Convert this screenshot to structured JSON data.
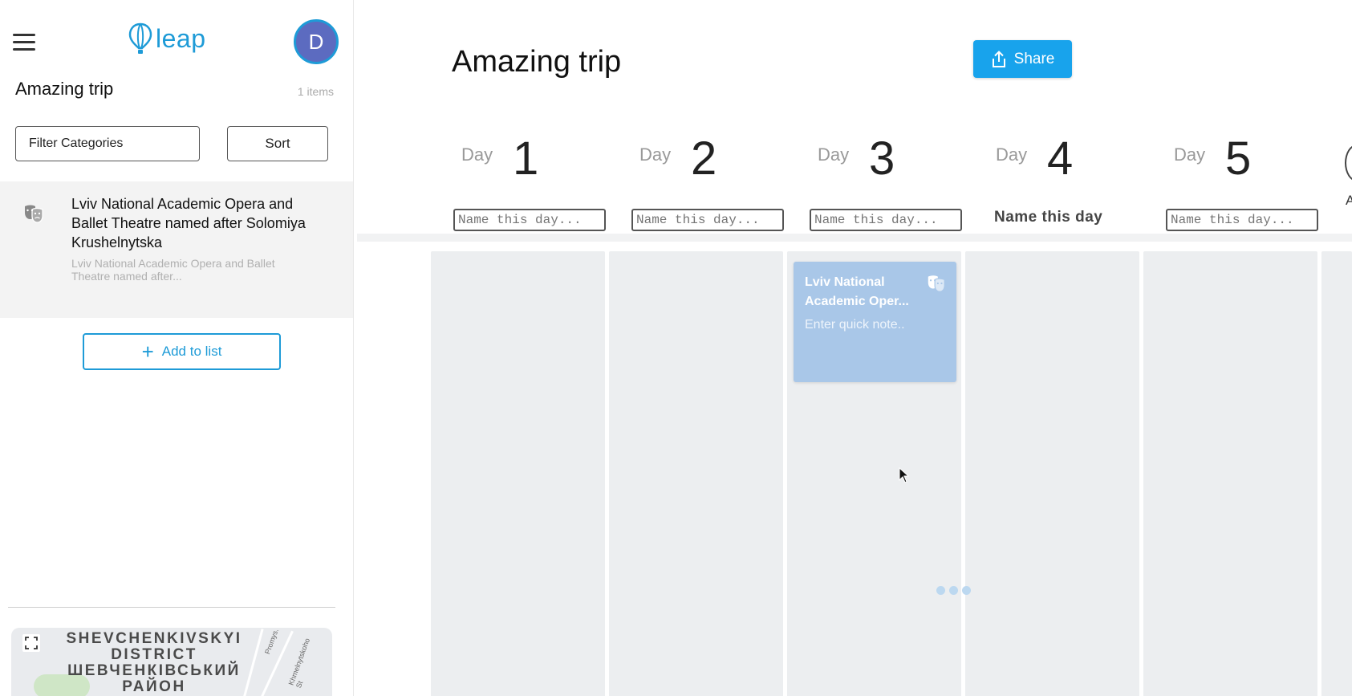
{
  "sidebar": {
    "logo_text": "leap",
    "avatar_initial": "D",
    "trip_title": "Amazing trip",
    "items_count": "1 items",
    "filter_label": "Filter Categories",
    "sort_label": "Sort",
    "items": [
      {
        "title": "Lviv National Academic Opera and Ballet Theatre named after Solomiya Krushelnytska",
        "description": "Lviv National Academic Opera and Ballet Theatre named after...",
        "icon": "theatre-masks-icon"
      }
    ],
    "add_to_list_label": "Add to list",
    "map": {
      "district_en_1": "SHEVCHENKIVSKYI",
      "district_en_2": "DISTRICT",
      "district_uk_1": "ШЕВЧЕНКІВСЬКИЙ",
      "district_uk_2": "РАЙОН",
      "street_1": "Promys.",
      "street_2": "Khmelnytskoho St"
    }
  },
  "main": {
    "title": "Amazing trip",
    "share_label": "Share",
    "day_word": "Day",
    "day_input_placeholder": "Name this day...",
    "days": [
      {
        "number": "1"
      },
      {
        "number": "2"
      },
      {
        "number": "3"
      },
      {
        "number": "4",
        "name_label": "Name this day"
      },
      {
        "number": "5"
      }
    ],
    "partial_next_label": "Ac",
    "card": {
      "title": "Lviv National Academic Oper...",
      "note_placeholder": "Enter quick note.."
    }
  },
  "colors": {
    "accent": "#1e9bd7",
    "share_button": "#18a3ec",
    "avatar": "#5c6bc0",
    "card": "#a9c7e8",
    "column": "#eceef0"
  }
}
